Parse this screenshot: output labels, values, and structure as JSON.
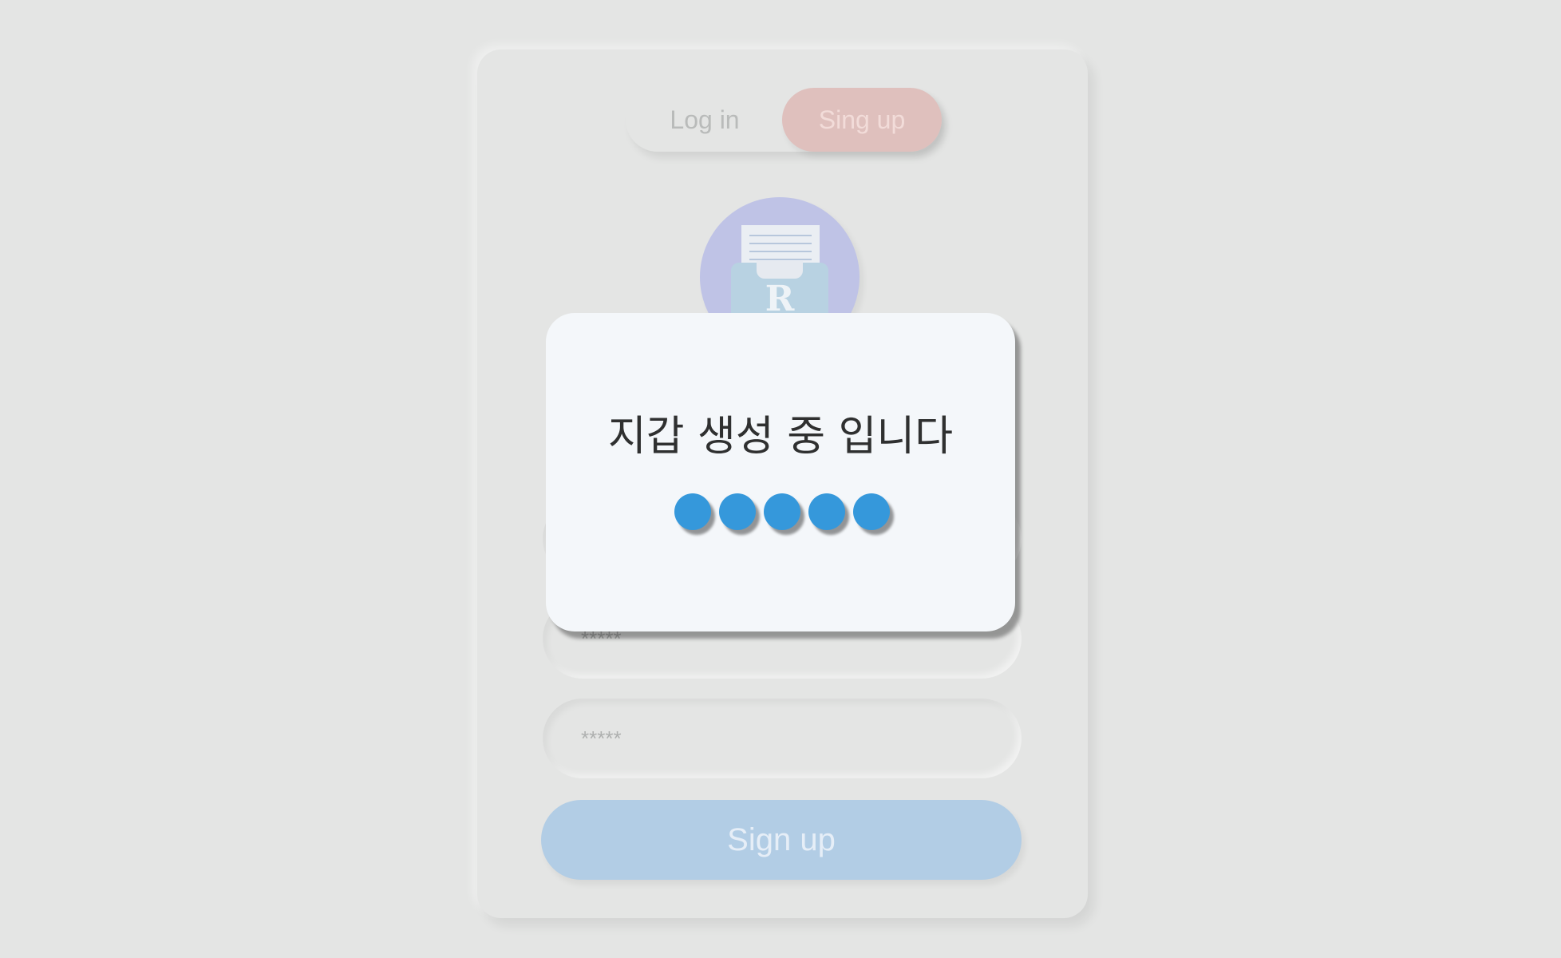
{
  "tabs": {
    "login_label": "Log in",
    "signup_label": "Sing up"
  },
  "avatar": {
    "letter": "R",
    "icon": "document-tray-icon"
  },
  "form": {
    "field1_placeholder": "",
    "field2_placeholder": "*****",
    "field3_placeholder": "*****",
    "submit_label": "Sign up"
  },
  "modal": {
    "title": "지갑 생성 중 입니다",
    "loader_dot_count": 5
  },
  "colors": {
    "background": "#e4e5e4",
    "tab_active": "#dfc0bd",
    "avatar": "#bfc3e6",
    "button": "#b2cde5",
    "modal": "#f4f7fa",
    "loader_dot": "#3598db"
  }
}
